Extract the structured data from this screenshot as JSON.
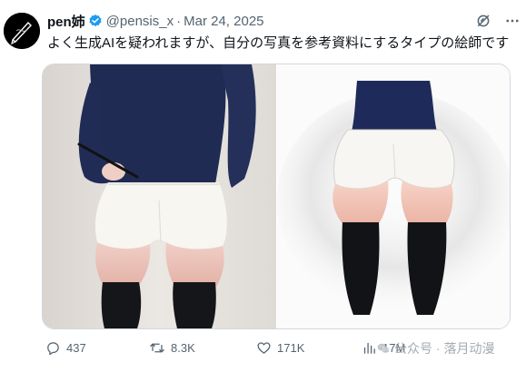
{
  "author": {
    "display_name": "pen姉",
    "handle": "@pensis_x",
    "separator": "·",
    "date": "Mar 24, 2025",
    "avatar_icon": "pen-sketch-avatar",
    "verified_icon": "verified-badge-icon",
    "verified_color": "#1d9bf0"
  },
  "tweet": {
    "text": "よく生成AIを疑われますが、自分の写真を参考資料にするタイプの絵師です"
  },
  "media": {
    "images": [
      "reference-photo",
      "illustration"
    ]
  },
  "actions": {
    "reply_count": "437",
    "repost_count": "8.3K",
    "like_count": "171K",
    "views_count": "17M"
  },
  "watermark": {
    "text": "公众号 · 落月动漫"
  },
  "colors": {
    "text": "#0f1419",
    "secondary": "#536471",
    "border": "#cfd9de",
    "accent": "#1d9bf0"
  }
}
